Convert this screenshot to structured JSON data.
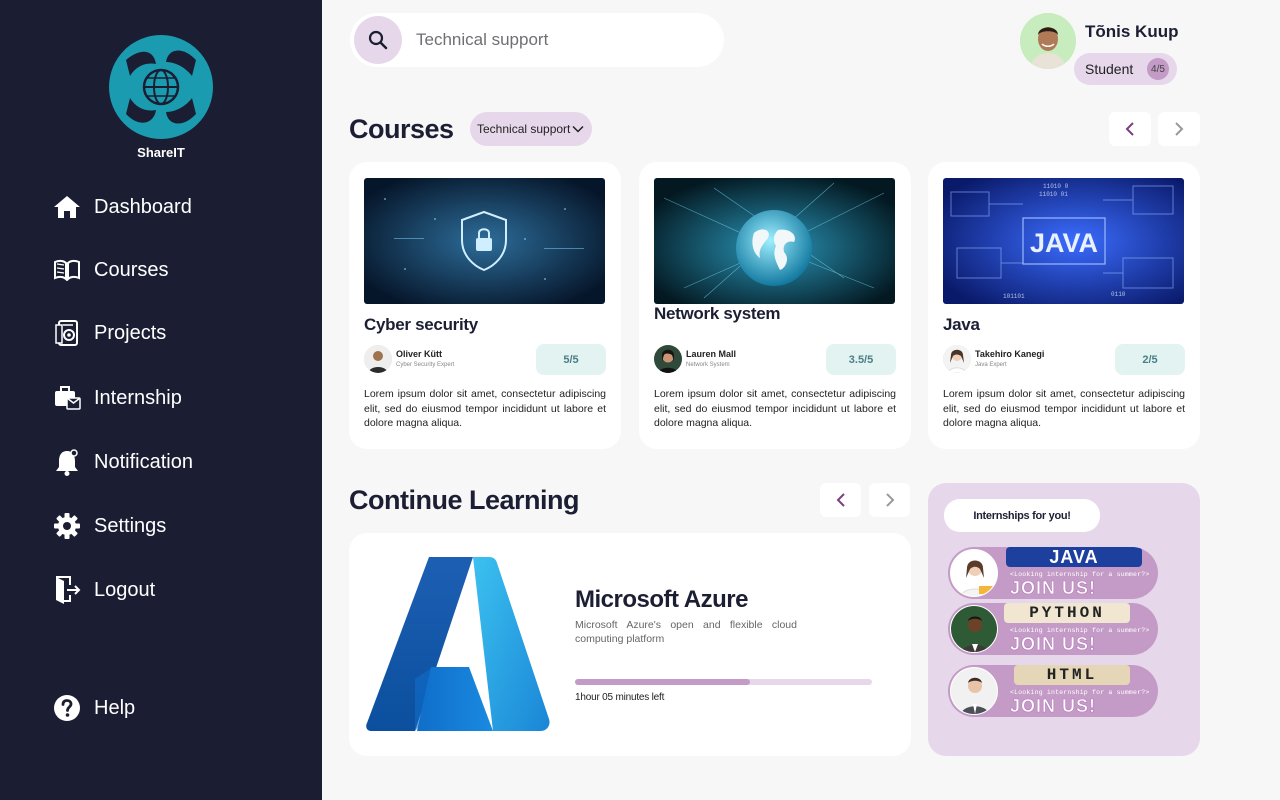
{
  "brand": {
    "name": "ShareIT"
  },
  "sidebar": {
    "items": [
      {
        "label": "Dashboard",
        "icon": "home-icon"
      },
      {
        "label": "Courses",
        "icon": "book-icon"
      },
      {
        "label": "Projects",
        "icon": "projects-icon"
      },
      {
        "label": "Internship",
        "icon": "briefcase-icon"
      },
      {
        "label": "Notification",
        "icon": "bell-icon"
      },
      {
        "label": "Settings",
        "icon": "gear-icon"
      },
      {
        "label": "Logout",
        "icon": "logout-icon"
      }
    ],
    "help": {
      "label": "Help",
      "icon": "help-icon"
    }
  },
  "search": {
    "placeholder": "Technical support"
  },
  "profile": {
    "name": "Tõnis Kuup",
    "role": "Student",
    "badge": "4/5"
  },
  "courses": {
    "title": "Courses",
    "filter": "Technical support",
    "items": [
      {
        "title": "Cyber security",
        "author": "Oliver Kütt",
        "author_role": "Cyber Security Expert",
        "rating": "5/5",
        "description": "Lorem ipsum dolor sit amet, consectetur adipiscing elit, sed do eiusmod tempor incididunt ut labore et dolore magna aliqua.",
        "image_text": ""
      },
      {
        "title": "Network system",
        "author": "Lauren Mall",
        "author_role": "Network System",
        "rating": "3.5/5",
        "description": "Lorem ipsum dolor sit amet, consectetur adipiscing elit, sed do eiusmod tempor incididunt ut labore et dolore magna aliqua.",
        "image_text": ""
      },
      {
        "title": "Java",
        "author": "Takehiro Kanegi",
        "author_role": "Java Expert",
        "rating": "2/5",
        "description": "Lorem ipsum dolor sit amet, consectetur adipiscing elit, sed do eiusmod tempor incididunt ut labore et dolore magna aliqua.",
        "image_text": "JAVA"
      }
    ]
  },
  "continue_learning": {
    "title": "Continue Learning",
    "course": {
      "title": "Microsoft Azure",
      "description": "Microsoft Azure's open and flexible cloud computing platform",
      "progress": 0.59,
      "time_left": "1hour 05 minutes left"
    }
  },
  "internships": {
    "header": "Internships for you!",
    "banners": [
      {
        "tag": "JAVA",
        "subtitle": "<Looking internship for a summer?>",
        "cta": "JOIN US!"
      },
      {
        "tag": "PYTHON",
        "subtitle": "<Looking internship for a summer?>",
        "cta": "JOIN US!"
      },
      {
        "tag": "HTML",
        "subtitle": "<Looking internship for a summer?>",
        "cta": "JOIN US!"
      }
    ]
  },
  "colors": {
    "sidebar": "#1b1e32",
    "accent": "#e6d8ea",
    "accent_dark": "#c39bc6",
    "rating_bg": "#e3f3f2"
  }
}
